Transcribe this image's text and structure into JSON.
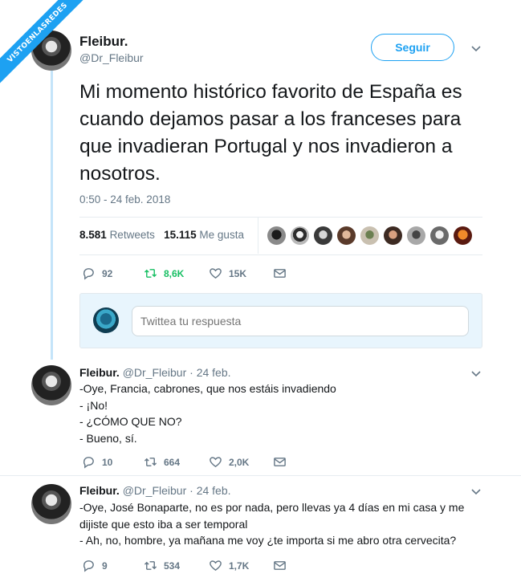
{
  "watermark": "VISTOENLASREDES",
  "main_tweet": {
    "name": "Fleibur.",
    "handle": "@Dr_Fleibur",
    "follow_label": "Seguir",
    "text": "Mi momento histórico favorito de España es cuando dejamos pasar a los franceses para que invadieran Portugal y nos invadieron a nosotros.",
    "timestamp": "0:50 - 24 feb. 2018",
    "retweets_count": "8.581",
    "retweets_label": "Retweets",
    "likes_count": "15.115",
    "likes_label": "Me gusta",
    "actions": {
      "replies": "92",
      "retweets": "8,6K",
      "likes": "15K"
    }
  },
  "reply_box": {
    "placeholder": "Twittea tu respuesta"
  },
  "replies": [
    {
      "name": "Fleibur.",
      "handle": "@Dr_Fleibur",
      "date": "· 24 feb.",
      "lines": [
        "-Oye, Francia, cabrones, que nos estáis invadiendo",
        "- ¡No!",
        "- ¿CÓMO QUE NO?",
        "- Bueno, sí."
      ],
      "actions": {
        "replies": "10",
        "retweets": "664",
        "likes": "2,0K"
      }
    },
    {
      "name": "Fleibur.",
      "handle": "@Dr_Fleibur",
      "date": "· 24 feb.",
      "lines": [
        "-Oye, José Bonaparte, no es por nada, pero llevas ya 4 días en mi casa y me",
        "dijiste que esto iba a ser temporal",
        "- Ah, no, hombre, ya mañana me voy ¿te importa si me abro otra cervecita?"
      ],
      "actions": {
        "replies": "9",
        "retweets": "534",
        "likes": "1,7K"
      }
    }
  ],
  "colors": {
    "accent": "#1da1f2",
    "retweeted": "#17bf63",
    "muted": "#657786",
    "thread": "#c4e4f9"
  },
  "icons": [
    "reply-icon",
    "retweet-icon",
    "heart-icon",
    "message-icon",
    "chevron-down-icon"
  ]
}
